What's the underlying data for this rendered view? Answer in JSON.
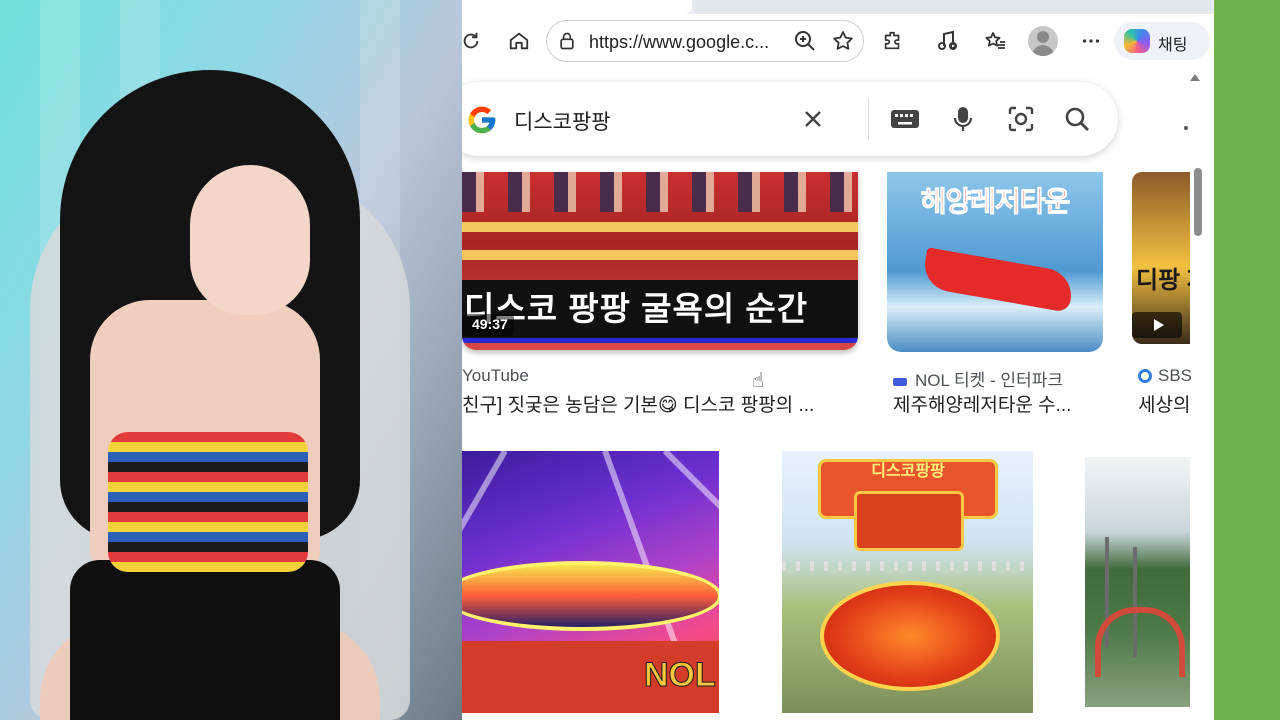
{
  "browser": {
    "url": "https://www.google.c...",
    "copilot_label": "채팅"
  },
  "search": {
    "query": "디스코팡팡"
  },
  "results": [
    {
      "caption": "디스코 팡팡 굴욕의 순간",
      "duration": "49:37",
      "source": "YouTube",
      "title": "친구] 짓궂은 농담은 기본😋 디스코 팡팡의 ..."
    },
    {
      "thumb_title": "해양레저타운",
      "source": "NOL 티켓 - 인터파크",
      "title": "제주해양레저타운 수..."
    },
    {
      "thumb_title": "디팡 제주",
      "source": "SBS",
      "title": "세상의"
    }
  ],
  "images": [
    {
      "label": "NOL"
    },
    {
      "label": "디스코팡팡"
    },
    {
      "label": ""
    }
  ],
  "colors": {
    "accent_green": "#6db24a",
    "link_text": "#202124",
    "source_text": "#4d5156"
  },
  "icons": [
    "refresh-icon",
    "home-icon",
    "lock-icon",
    "zoom-icon",
    "star-icon",
    "extensions-icon",
    "media-icon",
    "favorites-icon",
    "profile-avatar",
    "more-icon",
    "copilot-icon",
    "google-logo",
    "clear-icon",
    "keyboard-icon",
    "mic-icon",
    "lens-icon",
    "search-icon"
  ]
}
